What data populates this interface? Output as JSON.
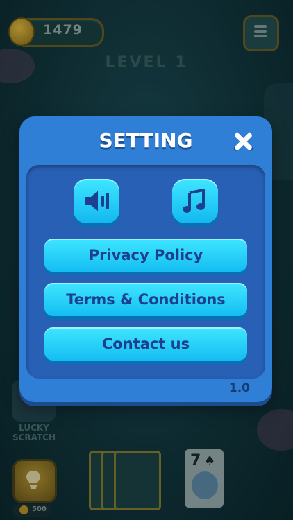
{
  "hud": {
    "coins": "1479",
    "level": "LEVEL 1"
  },
  "dialog": {
    "title": "SETTING",
    "buttons": {
      "privacy": "Privacy Policy",
      "terms": "Terms & Conditions",
      "contact": "Contact us"
    },
    "version": "1.0"
  },
  "bottom": {
    "lucky_scratch": "LUCKY SCRATCH",
    "hint_cost": "500",
    "face_card_rank": "7",
    "face_card_suit": "♠"
  },
  "icons": {
    "sound": "speaker-icon",
    "music": "music-note-icon",
    "close": "close-icon",
    "menu": "hamburger-menu-icon",
    "hint": "lightbulb-icon"
  },
  "colors": {
    "dialog_bg": "#2f7fd6",
    "inner_panel": "#2860b6",
    "button_cyan": "#3fe6ff",
    "button_text": "#1c3f8e"
  }
}
